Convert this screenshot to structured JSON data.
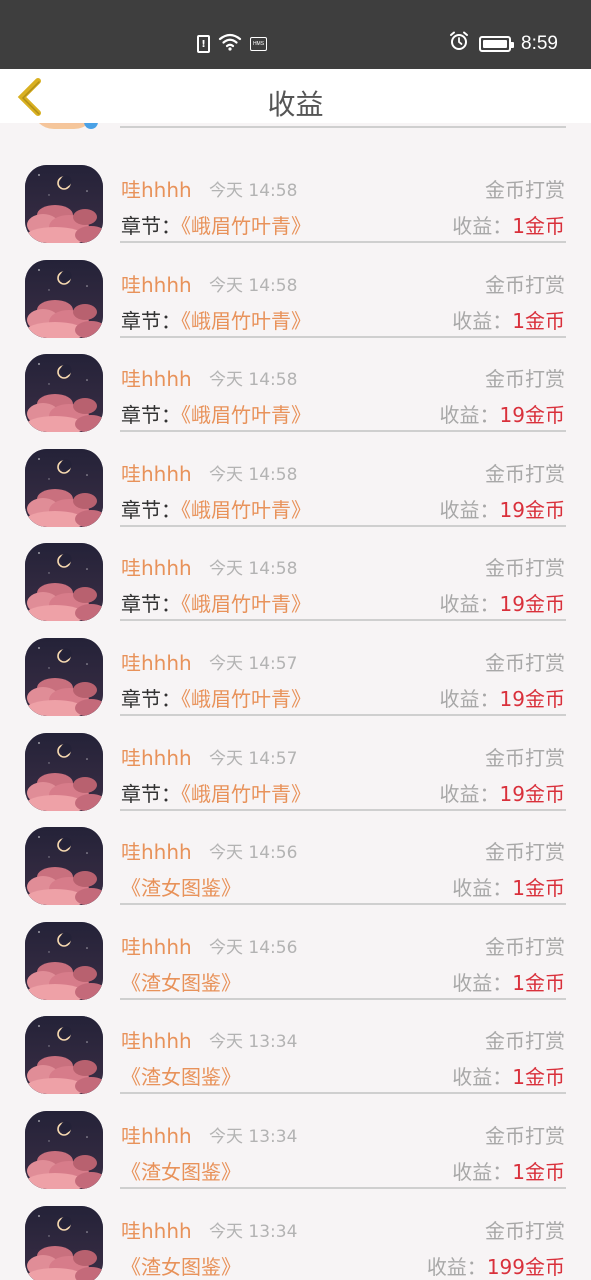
{
  "status_bar": {
    "time": "8:59",
    "icons": [
      "sim-alert-icon",
      "wifi-icon",
      "hms-icon",
      "alarm-icon",
      "battery-icon"
    ]
  },
  "header": {
    "title": "收益",
    "back_icon": "chevron-left-icon"
  },
  "colors": {
    "accent_orange": "#e8925a",
    "earning_red": "#d9303b",
    "muted_gray": "#a8a8a8",
    "back_icon_yellow": "#d9b020"
  },
  "items": [
    {
      "user": "哇hhhh",
      "time": "今天 14:58",
      "type": "金币打赏",
      "chapter_label": "章节：",
      "chapter": "《峨眉竹叶青》",
      "earn_label": "收益：",
      "earn": "1金币"
    },
    {
      "user": "哇hhhh",
      "time": "今天 14:58",
      "type": "金币打赏",
      "chapter_label": "章节：",
      "chapter": "《峨眉竹叶青》",
      "earn_label": "收益：",
      "earn": "1金币"
    },
    {
      "user": "哇hhhh",
      "time": "今天 14:58",
      "type": "金币打赏",
      "chapter_label": "章节：",
      "chapter": "《峨眉竹叶青》",
      "earn_label": "收益：",
      "earn": "19金币"
    },
    {
      "user": "哇hhhh",
      "time": "今天 14:58",
      "type": "金币打赏",
      "chapter_label": "章节：",
      "chapter": "《峨眉竹叶青》",
      "earn_label": "收益：",
      "earn": "19金币"
    },
    {
      "user": "哇hhhh",
      "time": "今天 14:58",
      "type": "金币打赏",
      "chapter_label": "章节：",
      "chapter": "《峨眉竹叶青》",
      "earn_label": "收益：",
      "earn": "19金币"
    },
    {
      "user": "哇hhhh",
      "time": "今天 14:57",
      "type": "金币打赏",
      "chapter_label": "章节：",
      "chapter": "《峨眉竹叶青》",
      "earn_label": "收益：",
      "earn": "19金币"
    },
    {
      "user": "哇hhhh",
      "time": "今天 14:57",
      "type": "金币打赏",
      "chapter_label": "章节：",
      "chapter": "《峨眉竹叶青》",
      "earn_label": "收益：",
      "earn": "19金币"
    },
    {
      "user": "哇hhhh",
      "time": "今天 14:56",
      "type": "金币打赏",
      "chapter_label": "",
      "chapter": "《渣女图鉴》",
      "earn_label": "收益：",
      "earn": "1金币"
    },
    {
      "user": "哇hhhh",
      "time": "今天 14:56",
      "type": "金币打赏",
      "chapter_label": "",
      "chapter": "《渣女图鉴》",
      "earn_label": "收益：",
      "earn": "1金币"
    },
    {
      "user": "哇hhhh",
      "time": "今天 13:34",
      "type": "金币打赏",
      "chapter_label": "",
      "chapter": "《渣女图鉴》",
      "earn_label": "收益：",
      "earn": "1金币"
    },
    {
      "user": "哇hhhh",
      "time": "今天 13:34",
      "type": "金币打赏",
      "chapter_label": "",
      "chapter": "《渣女图鉴》",
      "earn_label": "收益：",
      "earn": "1金币"
    },
    {
      "user": "哇hhhh",
      "time": "今天 13:34",
      "type": "金币打赏",
      "chapter_label": "",
      "chapter": "《渣女图鉴》",
      "earn_label": "收益：",
      "earn": "199金币"
    }
  ]
}
